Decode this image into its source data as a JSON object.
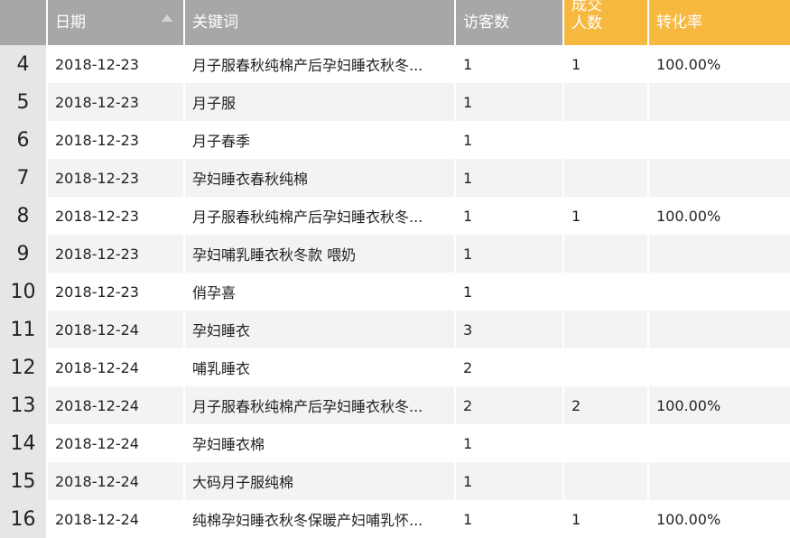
{
  "headers": {
    "date": "日期",
    "keyword": "关键词",
    "visitors": "访客数",
    "deals_line1": "成交",
    "deals_line2": "人数",
    "conversion": "转化率"
  },
  "rows": [
    {
      "n": "4",
      "date": "2018-12-23",
      "keyword": "月子服春秋纯棉产后孕妇睡衣秋冬...",
      "visitors": "1",
      "deals": "1",
      "rate": "100.00%"
    },
    {
      "n": "5",
      "date": "2018-12-23",
      "keyword": "月子服",
      "visitors": "1",
      "deals": "",
      "rate": ""
    },
    {
      "n": "6",
      "date": "2018-12-23",
      "keyword": "月子春季",
      "visitors": "1",
      "deals": "",
      "rate": ""
    },
    {
      "n": "7",
      "date": "2018-12-23",
      "keyword": "孕妇睡衣春秋纯棉",
      "visitors": "1",
      "deals": "",
      "rate": ""
    },
    {
      "n": "8",
      "date": "2018-12-23",
      "keyword": "月子服春秋纯棉产后孕妇睡衣秋冬...",
      "visitors": "1",
      "deals": "1",
      "rate": "100.00%"
    },
    {
      "n": "9",
      "date": "2018-12-23",
      "keyword": "孕妇哺乳睡衣秋冬款 喂奶",
      "visitors": "1",
      "deals": "",
      "rate": ""
    },
    {
      "n": "10",
      "date": "2018-12-23",
      "keyword": "俏孕喜",
      "visitors": "1",
      "deals": "",
      "rate": ""
    },
    {
      "n": "11",
      "date": "2018-12-24",
      "keyword": "孕妇睡衣",
      "visitors": "3",
      "deals": "",
      "rate": ""
    },
    {
      "n": "12",
      "date": "2018-12-24",
      "keyword": "哺乳睡衣",
      "visitors": "2",
      "deals": "",
      "rate": ""
    },
    {
      "n": "13",
      "date": "2018-12-24",
      "keyword": "月子服春秋纯棉产后孕妇睡衣秋冬...",
      "visitors": "2",
      "deals": "2",
      "rate": "100.00%"
    },
    {
      "n": "14",
      "date": "2018-12-24",
      "keyword": "孕妇睡衣棉",
      "visitors": "1",
      "deals": "",
      "rate": ""
    },
    {
      "n": "15",
      "date": "2018-12-24",
      "keyword": "大码月子服纯棉",
      "visitors": "1",
      "deals": "",
      "rate": ""
    },
    {
      "n": "16",
      "date": "2018-12-24",
      "keyword": "纯棉孕妇睡衣秋冬保暖产妇哺乳怀...",
      "visitors": "1",
      "deals": "1",
      "rate": "100.00%"
    }
  ],
  "colors": {
    "header_gray": "#a7a7a7",
    "header_orange": "#f7b83f",
    "row_alt": "#f3f3f3",
    "rownum_bg": "#e6e6e6"
  },
  "icons": {
    "sort": "sort-up-icon"
  }
}
